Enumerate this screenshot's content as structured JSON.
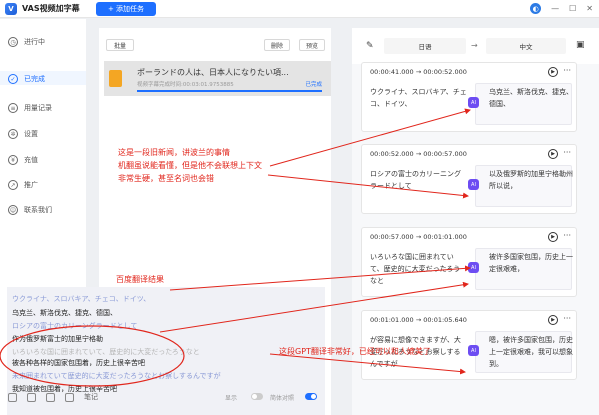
{
  "app": {
    "title": "VAS视频加字幕",
    "add_task": "+ 添加任务"
  },
  "sidebar": {
    "items": [
      {
        "label": "进行中",
        "icon": "clock-icon"
      },
      {
        "label": "已完成",
        "icon": "check-circle-icon"
      },
      {
        "label": "用量记录",
        "icon": "record-icon"
      },
      {
        "label": "设置",
        "icon": "gear-icon"
      },
      {
        "label": "充值",
        "icon": "recharge-icon"
      },
      {
        "label": "推广",
        "icon": "share-icon"
      },
      {
        "label": "联系我们",
        "icon": "contact-icon"
      }
    ],
    "active_index": 1
  },
  "left": {
    "batch": "批量",
    "delete": "删除",
    "preview": "预览",
    "file": {
      "name": "ポーランドの人は、日本人になりたい項...",
      "meta": "视频字幕完成时间:00:03:01.9753885",
      "status": "已完成",
      "progress": 1.0
    }
  },
  "text_panel": {
    "lines": [
      {
        "text": "ウクライナ、スロバキア、チェコ、ドイツ、",
        "kind": "jp"
      },
      {
        "text": "乌克兰、斯洛伐克、捷克、德国、",
        "kind": "zh"
      },
      {
        "text": "ロシアの富士のカリーングラードとして",
        "kind": "jp"
      },
      {
        "text": "作为俄罗斯富士的加里宁格勒",
        "kind": "zh"
      },
      {
        "text": "いろいろな国に囲まれていて、歴史的に大変だったろうなと",
        "kind": "muted"
      },
      {
        "text": "被各种各样的国家包围着，历史上很辛苦吧",
        "kind": "zh"
      },
      {
        "text": "未来囲まれていて歴史的に大変だったろうなとお察しするんですが",
        "kind": "jp"
      },
      {
        "text": "我知道被包围着，历史上很辛苦吧",
        "kind": "zh"
      }
    ],
    "footer_label": "笔记",
    "toggle_a": "显示",
    "toggle_b": "简体对照"
  },
  "right": {
    "source_lang": "日语",
    "target_lang": "中文",
    "segments": [
      {
        "time": "00:00:41.000 → 00:00:52.000",
        "source": "ウクライナ、スロバキア、チェコ、ドイツ、",
        "translation": "乌克兰、斯洛伐克、捷克、德国、"
      },
      {
        "time": "00:00:52.000 → 00:00:57.000",
        "source": "ロシアの富士のカリーニングラードとして",
        "translation": "以及俄罗斯的加里宁格勒州所以说，"
      },
      {
        "time": "00:00:57.000 → 00:01:01.000",
        "source": "いろいろな国に囲まれていて、歴史的に大変だったろうなと",
        "translation": "被许多国家包围，历史上一定很艰难，"
      },
      {
        "time": "00:01:01.000 → 00:01:05.640",
        "source": "が容易に想像できますが、大変だったろうなとお察しするんですが",
        "translation": "嗯，被许多国家包围，历史上一定很艰难，我可以想象到。"
      }
    ]
  },
  "annotations": {
    "note1_line1": "这是一段旧新闻，讲波兰的事情",
    "note1_line2": "机翻虽说能看懂，但是他不会联想上下文",
    "note1_line3": "非常生硬，甚至名词也会错",
    "note2": "百度翻译结果",
    "note3": "这段GPT翻译非常好，已经可以和人媲美了"
  },
  "colors": {
    "accent": "#1e6fff",
    "annotation": "#e1261c",
    "ai_badge": "#6d4df2"
  }
}
